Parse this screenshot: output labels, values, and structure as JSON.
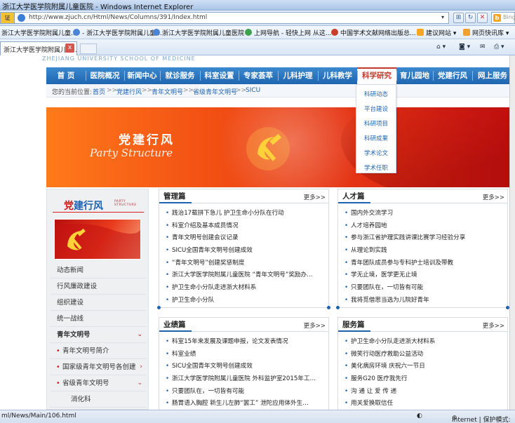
{
  "browser": {
    "title": "浙江大学医学院附属儿童医院 - Windows Internet Explorer",
    "address_prefix": "证",
    "url": "http://www.zjuch.cn/Html/News/Columns/391/Index.html",
    "search_placeholder": "Bing",
    "favorites": [
      "浙江大学医学院附属儿童...",
      "- 浙江大学医学院附属儿童...",
      "浙江大学医学院附属儿童医院",
      "上网导航 - 轻快上网 从这...",
      "中国学术文献网络出版总...",
      "建议网站 ▾",
      "网页快讯库 ▾"
    ],
    "tab_label": "浙江大学医学院附属儿童...",
    "tab_close": "x",
    "status_url": "ml/News/Main/106.html",
    "status_zone": "Internet | 保护模式:"
  },
  "site": {
    "school_top": "ZHEJIANG UNIVERSITY SCHOOL OF MEDICINE",
    "nav": [
      "首 页",
      "医院概况",
      "新闻中心",
      "就诊服务",
      "科室设置",
      "专家荟萃",
      "儿科护理",
      "儿科教学",
      "科学研究",
      "育儿园地",
      "党建行风",
      "网上服务"
    ],
    "nav_active_index": 8,
    "breadcrumb": {
      "label": "您的当前位置:",
      "items": [
        "首页",
        "党建行风",
        "青年文明号",
        "省级青年文明号",
        "SICU"
      ],
      "sep": ">>"
    },
    "dropdown": [
      "科研动态",
      "平台建设",
      "科研项目",
      "科研成果",
      "学术论文",
      "学术任职"
    ],
    "banner": {
      "title": "党建行风",
      "subtitle": "Party Structure"
    },
    "sidebar": {
      "header_accent": "党",
      "header_rest": "建行风",
      "header_en": "PARTY STRUCTURE",
      "items": [
        {
          "label": "动态新闻",
          "type": "normal"
        },
        {
          "label": "行风廉政建设",
          "type": "normal"
        },
        {
          "label": "组织建设",
          "type": "normal"
        },
        {
          "label": "统一战线",
          "type": "normal"
        },
        {
          "label": "青年文明号",
          "type": "bold",
          "arrow": "⌄"
        },
        {
          "label": "青年文明号简介",
          "type": "sub"
        },
        {
          "label": "国家级青年文明号各创建",
          "type": "sub",
          "arrow": "›"
        },
        {
          "label": "省级青年文明号",
          "type": "sub",
          "arrow": "⌄"
        },
        {
          "label": "消化科",
          "type": "sub2"
        }
      ]
    },
    "boxes": [
      {
        "title": "管理篇",
        "more": "更多>>",
        "items": [
          "践治17载拼下急儿 护卫生命小分队在行动",
          "科室介绍及基本成员情况",
          "青年文明号创建会议记录",
          "SICU全国青年文明号创建成效",
          "“青年文明号”创建奖惩制度",
          "浙江大学医学院附属儿童医院 “青年文明号”奖励办…",
          "护卫生命小分队走进浙大材料系",
          "护卫生命小分队"
        ]
      },
      {
        "title": "人才篇",
        "more": "更多>>",
        "items": [
          "国内外交流学习",
          "人才培养园地",
          "参与浙江省护理实践讲课比赛学习经验分享",
          "从理论到实践",
          "青年团队成员参与专科护士培训及带教",
          "学无止境，医学更无止境",
          "只要团队在，一切皆有可能",
          "我将觅借思当选为儿院好青年"
        ]
      },
      {
        "title": "业绩篇",
        "more": "更多>>",
        "items": [
          "科室15年来发展及课题申报，论文发表情况",
          "科室业绩",
          "SICU全国青年文明号创建成效",
          "浙江大学医学院附属儿童医院 外科监护室2015年工…",
          "只要团队在，一切皆有可能",
          "肠胃语入胸腔 新生儿左肺“罢工” 泄陀应用体外生…"
        ]
      },
      {
        "title": "服务篇",
        "more": "更多>>",
        "items": [
          "护卫生命小分队走进浙大材料系",
          "微笑行动医疗救助公益活动",
          "美化病房环境 庆祝六一节日",
          "服务G20 医疗我先行",
          "沟 通 让 爱 传 递",
          "用关爱换取信任"
        ]
      }
    ]
  },
  "colors": {
    "nav_blue": "#1f66b0",
    "accent_red": "#d01b1b",
    "link_blue": "#1e63b0"
  }
}
